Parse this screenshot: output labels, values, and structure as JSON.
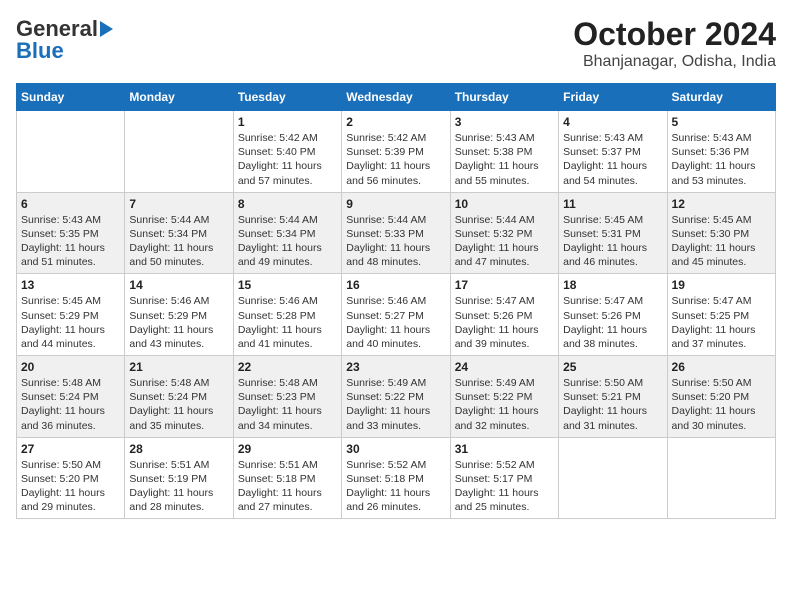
{
  "header": {
    "logo_general": "General",
    "logo_blue": "Blue",
    "title": "October 2024",
    "subtitle": "Bhanjanagar, Odisha, India"
  },
  "days_of_week": [
    "Sunday",
    "Monday",
    "Tuesday",
    "Wednesday",
    "Thursday",
    "Friday",
    "Saturday"
  ],
  "weeks": [
    [
      {
        "day": "",
        "info": ""
      },
      {
        "day": "",
        "info": ""
      },
      {
        "day": "1",
        "info": "Sunrise: 5:42 AM\nSunset: 5:40 PM\nDaylight: 11 hours and 57 minutes."
      },
      {
        "day": "2",
        "info": "Sunrise: 5:42 AM\nSunset: 5:39 PM\nDaylight: 11 hours and 56 minutes."
      },
      {
        "day": "3",
        "info": "Sunrise: 5:43 AM\nSunset: 5:38 PM\nDaylight: 11 hours and 55 minutes."
      },
      {
        "day": "4",
        "info": "Sunrise: 5:43 AM\nSunset: 5:37 PM\nDaylight: 11 hours and 54 minutes."
      },
      {
        "day": "5",
        "info": "Sunrise: 5:43 AM\nSunset: 5:36 PM\nDaylight: 11 hours and 53 minutes."
      }
    ],
    [
      {
        "day": "6",
        "info": "Sunrise: 5:43 AM\nSunset: 5:35 PM\nDaylight: 11 hours and 51 minutes."
      },
      {
        "day": "7",
        "info": "Sunrise: 5:44 AM\nSunset: 5:34 PM\nDaylight: 11 hours and 50 minutes."
      },
      {
        "day": "8",
        "info": "Sunrise: 5:44 AM\nSunset: 5:34 PM\nDaylight: 11 hours and 49 minutes."
      },
      {
        "day": "9",
        "info": "Sunrise: 5:44 AM\nSunset: 5:33 PM\nDaylight: 11 hours and 48 minutes."
      },
      {
        "day": "10",
        "info": "Sunrise: 5:44 AM\nSunset: 5:32 PM\nDaylight: 11 hours and 47 minutes."
      },
      {
        "day": "11",
        "info": "Sunrise: 5:45 AM\nSunset: 5:31 PM\nDaylight: 11 hours and 46 minutes."
      },
      {
        "day": "12",
        "info": "Sunrise: 5:45 AM\nSunset: 5:30 PM\nDaylight: 11 hours and 45 minutes."
      }
    ],
    [
      {
        "day": "13",
        "info": "Sunrise: 5:45 AM\nSunset: 5:29 PM\nDaylight: 11 hours and 44 minutes."
      },
      {
        "day": "14",
        "info": "Sunrise: 5:46 AM\nSunset: 5:29 PM\nDaylight: 11 hours and 43 minutes."
      },
      {
        "day": "15",
        "info": "Sunrise: 5:46 AM\nSunset: 5:28 PM\nDaylight: 11 hours and 41 minutes."
      },
      {
        "day": "16",
        "info": "Sunrise: 5:46 AM\nSunset: 5:27 PM\nDaylight: 11 hours and 40 minutes."
      },
      {
        "day": "17",
        "info": "Sunrise: 5:47 AM\nSunset: 5:26 PM\nDaylight: 11 hours and 39 minutes."
      },
      {
        "day": "18",
        "info": "Sunrise: 5:47 AM\nSunset: 5:26 PM\nDaylight: 11 hours and 38 minutes."
      },
      {
        "day": "19",
        "info": "Sunrise: 5:47 AM\nSunset: 5:25 PM\nDaylight: 11 hours and 37 minutes."
      }
    ],
    [
      {
        "day": "20",
        "info": "Sunrise: 5:48 AM\nSunset: 5:24 PM\nDaylight: 11 hours and 36 minutes."
      },
      {
        "day": "21",
        "info": "Sunrise: 5:48 AM\nSunset: 5:24 PM\nDaylight: 11 hours and 35 minutes."
      },
      {
        "day": "22",
        "info": "Sunrise: 5:48 AM\nSunset: 5:23 PM\nDaylight: 11 hours and 34 minutes."
      },
      {
        "day": "23",
        "info": "Sunrise: 5:49 AM\nSunset: 5:22 PM\nDaylight: 11 hours and 33 minutes."
      },
      {
        "day": "24",
        "info": "Sunrise: 5:49 AM\nSunset: 5:22 PM\nDaylight: 11 hours and 32 minutes."
      },
      {
        "day": "25",
        "info": "Sunrise: 5:50 AM\nSunset: 5:21 PM\nDaylight: 11 hours and 31 minutes."
      },
      {
        "day": "26",
        "info": "Sunrise: 5:50 AM\nSunset: 5:20 PM\nDaylight: 11 hours and 30 minutes."
      }
    ],
    [
      {
        "day": "27",
        "info": "Sunrise: 5:50 AM\nSunset: 5:20 PM\nDaylight: 11 hours and 29 minutes."
      },
      {
        "day": "28",
        "info": "Sunrise: 5:51 AM\nSunset: 5:19 PM\nDaylight: 11 hours and 28 minutes."
      },
      {
        "day": "29",
        "info": "Sunrise: 5:51 AM\nSunset: 5:18 PM\nDaylight: 11 hours and 27 minutes."
      },
      {
        "day": "30",
        "info": "Sunrise: 5:52 AM\nSunset: 5:18 PM\nDaylight: 11 hours and 26 minutes."
      },
      {
        "day": "31",
        "info": "Sunrise: 5:52 AM\nSunset: 5:17 PM\nDaylight: 11 hours and 25 minutes."
      },
      {
        "day": "",
        "info": ""
      },
      {
        "day": "",
        "info": ""
      }
    ]
  ]
}
